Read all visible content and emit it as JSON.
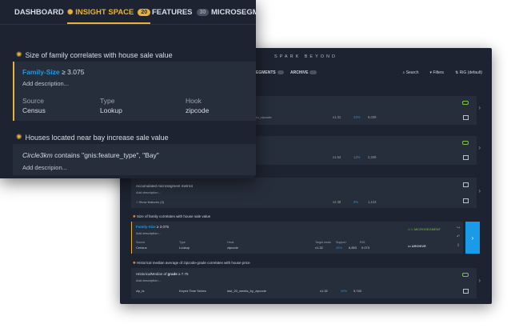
{
  "back_window": {
    "brand": "SPARK BEYOND",
    "nav": {
      "segments_label": "EGMENTS",
      "segments_count": "",
      "archive_label": "ARCHIVE",
      "archive_count": "",
      "search": "Search",
      "filters": "Filters",
      "rig": "RiG (default)"
    },
    "cards": [
      {
        "title": "",
        "meta": "_to_zipcode",
        "lift": "x1.31",
        "support": "42%",
        "count": "8,039"
      },
      {
        "title": "",
        "meta": "",
        "lift": "x1.54",
        "support": "12%",
        "count": "2,349"
      },
      {
        "title": "Accumulated microsegment metrics",
        "add": "Add description...",
        "show": "+ Show features (3)",
        "lift": "x2.38",
        "support": "6%",
        "count": "1,123"
      }
    ],
    "sections": [
      {
        "title": "Size of family correlates with house sale value"
      },
      {
        "title": "Historical median average of zipcode-grade correlates with house price"
      }
    ],
    "expanded": {
      "feature_name": "Family-Size",
      "feature_rest": "≥ 3.075",
      "add": "Add description...",
      "headers": [
        "Source",
        "Type",
        "Hook",
        "Target mean",
        "Support",
        "RIG"
      ],
      "values": [
        "Census",
        "Lookup",
        "zipcode",
        "x1.32",
        "45%",
        "6,853",
        "0.073"
      ],
      "microsegment": "MICROSEGMENT",
      "archive": "ARCHIVE"
    },
    "last_card": {
      "title_italic": "HistoricalMedian of",
      "title_bold": "grade",
      "title_rest": "≥ 7.75",
      "add": "Add description...",
      "values": [
        "zip_ts",
        "Keyed Time Series",
        "last_20_weeks_by_zipcode",
        "x1.32",
        "49%",
        "9,740"
      ]
    }
  },
  "front_window": {
    "tabs": [
      {
        "label": "DASHBOARD",
        "badge": ""
      },
      {
        "label": "INSIGHT SPACE",
        "badge": "20"
      },
      {
        "label": "FEATURES",
        "badge": "30"
      },
      {
        "label": "MICROSEGMENT",
        "badge": ""
      }
    ],
    "insight1": {
      "title": "Size of family correlates with house sale value",
      "feature_name": "Family-Size",
      "feature_rest": "≥ 3.075",
      "add": "Add description...",
      "source_label": "Source",
      "source": "Census",
      "type_label": "Type",
      "type": "Lookup",
      "hook_label": "Hook",
      "hook": "zipcode"
    },
    "insight2": {
      "title": "Houses located near bay increase sale value",
      "feature_italic": "Circle3km",
      "feature_rest": "contains \"gnis:feature_type\", \"Bay\"",
      "add": "Add descripion..."
    }
  },
  "colors": {
    "accent": "#e8b23a",
    "blue": "#1a9be8",
    "green": "#7fc241",
    "bg": "#1d2330",
    "card": "#262d3b"
  }
}
